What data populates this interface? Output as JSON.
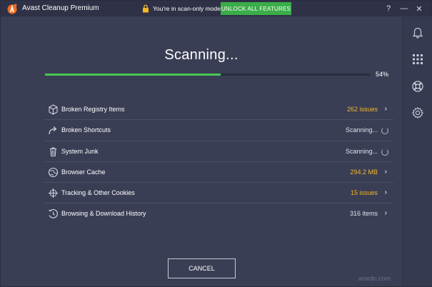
{
  "titlebar": {
    "app_title": "Avast Cleanup Premium",
    "mode_text": "You're in scan-only mode.",
    "unlock_label": "UNLOCK ALL FEATURES",
    "help_label": "?",
    "minimize_label": "—",
    "close_label": "✕"
  },
  "scan": {
    "title": "Scanning...",
    "progress_percent": 54,
    "progress_label": "54%"
  },
  "items": [
    {
      "label": "Broken Registry Items",
      "value": "262 issues",
      "icon": "registry-cube-icon",
      "status": "issues"
    },
    {
      "label": "Broken Shortcuts",
      "value": "Scanning...",
      "icon": "shortcut-arrow-icon",
      "status": "scanning"
    },
    {
      "label": "System Junk",
      "value": "Scanning...",
      "icon": "trash-can-icon",
      "status": "scanning"
    },
    {
      "label": "Browser Cache",
      "value": "294.2 MB",
      "icon": "globe-icon",
      "status": "issues"
    },
    {
      "label": "Tracking & Other Cookies",
      "value": "15 issues",
      "icon": "crosshair-icon",
      "status": "issues"
    },
    {
      "label": "Browsing & Download History",
      "value": "316 items",
      "icon": "history-clock-icon",
      "status": "items"
    }
  ],
  "cancel_label": "CANCEL",
  "sidebar_icons": [
    "bell-icon",
    "apps-grid-icon",
    "lifebuoy-icon",
    "gear-icon"
  ],
  "watermark": "wsxdn.com",
  "colors": {
    "accent_green": "#45c950",
    "unlock_green": "#3aad49",
    "issue_yellow": "#f5b824",
    "background": "#3a3e55",
    "logo_orange": "#f26a21"
  }
}
